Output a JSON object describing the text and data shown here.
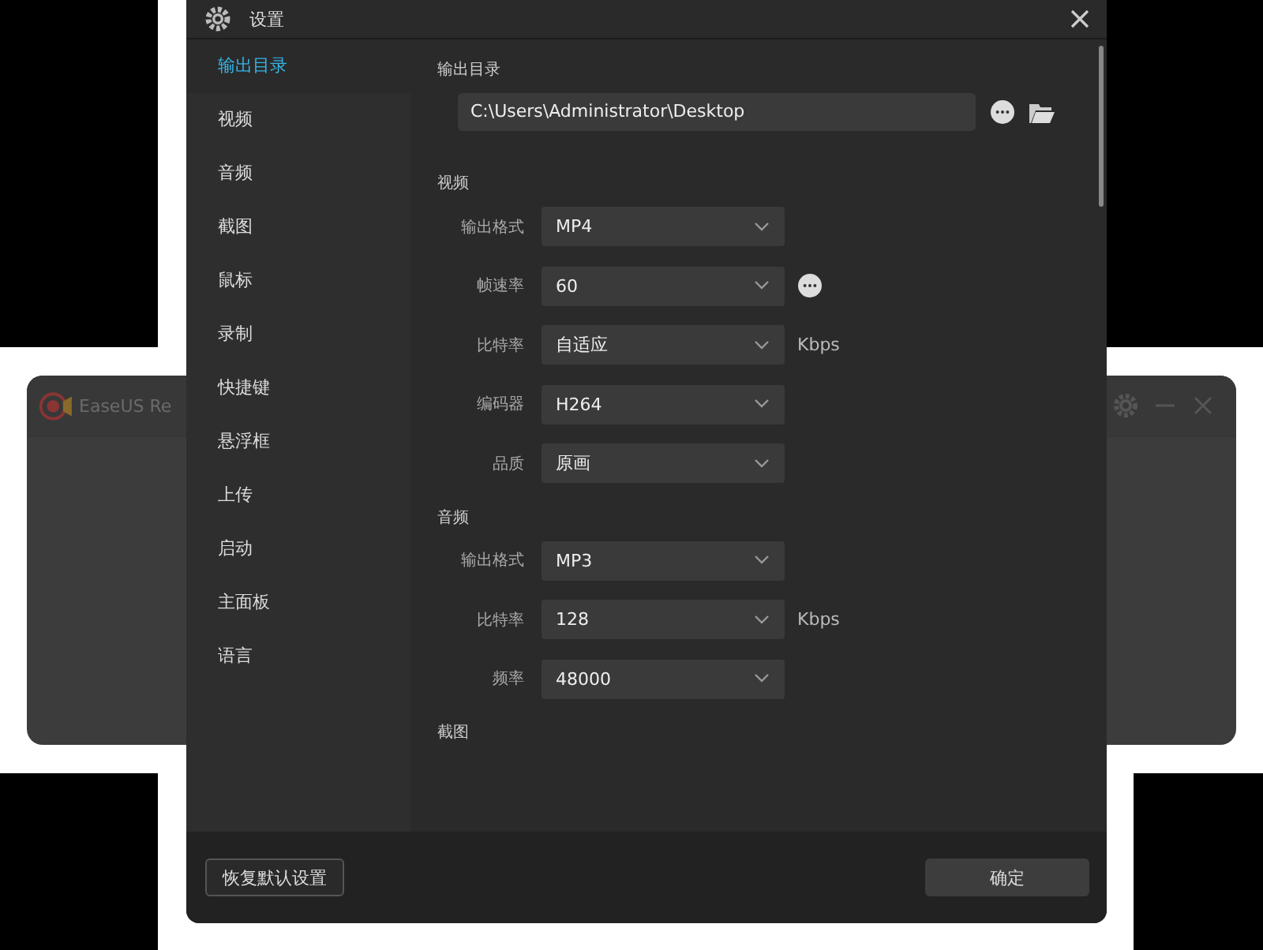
{
  "background_window": {
    "title": "EaseUS Re"
  },
  "dialog": {
    "title": "设置"
  },
  "sidebar": {
    "items": [
      {
        "label": "输出目录",
        "selected": true
      },
      {
        "label": "视频",
        "selected": false
      },
      {
        "label": "音频",
        "selected": false
      },
      {
        "label": "截图",
        "selected": false
      },
      {
        "label": "鼠标",
        "selected": false
      },
      {
        "label": "录制",
        "selected": false
      },
      {
        "label": "快捷键",
        "selected": false
      },
      {
        "label": "悬浮框",
        "selected": false
      },
      {
        "label": "上传",
        "selected": false
      },
      {
        "label": "启动",
        "selected": false
      },
      {
        "label": "主面板",
        "selected": false
      },
      {
        "label": "语言",
        "selected": false
      }
    ]
  },
  "sections": [
    {
      "heading": "输出目录",
      "kind": "path",
      "path": "C:\\Users\\Administrator\\Desktop"
    },
    {
      "heading": "视频",
      "kind": "form",
      "rows": [
        {
          "label": "输出格式",
          "value": "MP4"
        },
        {
          "label": "帧速率",
          "value": "60",
          "more_button": true
        },
        {
          "label": "比特率",
          "value": "自适应",
          "unit": "Kbps"
        },
        {
          "label": "编码器",
          "value": "H264"
        },
        {
          "label": "品质",
          "value": "原画"
        }
      ]
    },
    {
      "heading": "音频",
      "kind": "form",
      "rows": [
        {
          "label": "输出格式",
          "value": "MP3"
        },
        {
          "label": "比特率",
          "value": "128",
          "unit": "Kbps"
        },
        {
          "label": "频率",
          "value": "48000"
        }
      ]
    },
    {
      "heading": "截图",
      "kind": "form"
    }
  ],
  "footer": {
    "reset_button": "恢复默认设置",
    "ok_button": "确定"
  }
}
